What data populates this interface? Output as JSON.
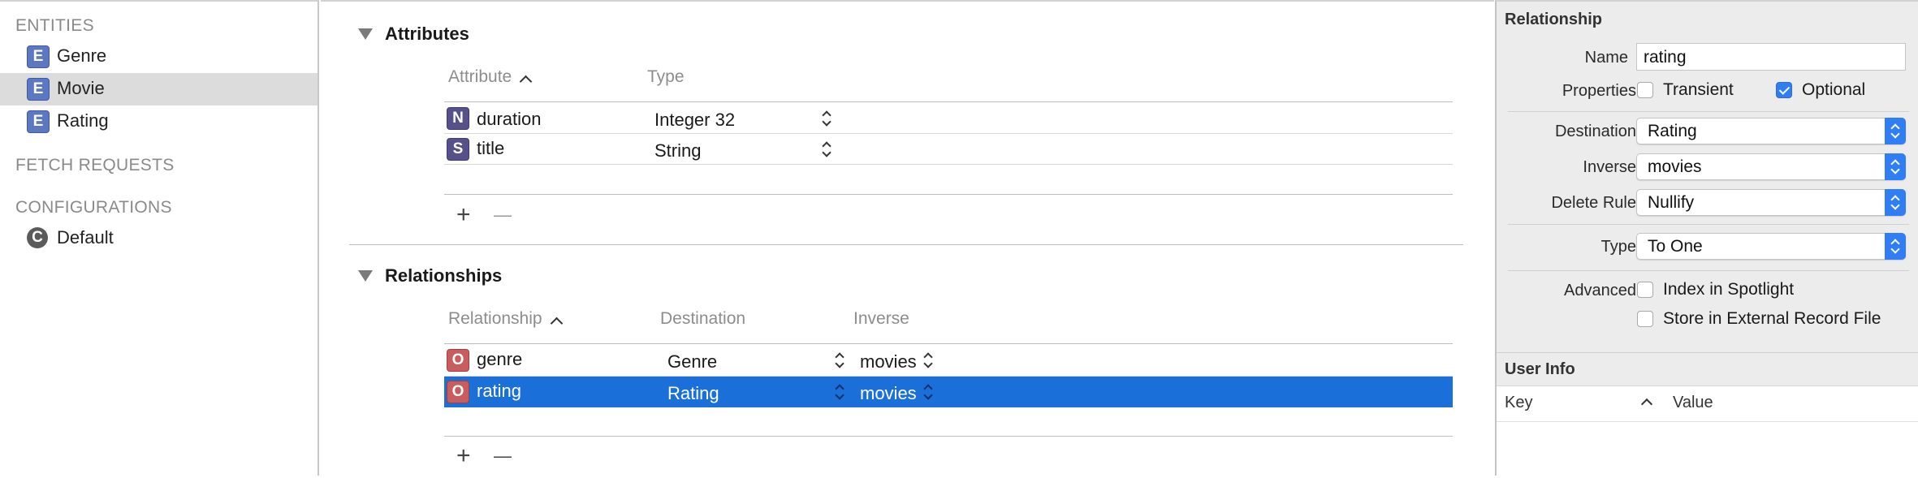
{
  "sidebar": {
    "entities_header": "ENTITIES",
    "entities": [
      {
        "badge": "E",
        "label": "Genre",
        "selected": false
      },
      {
        "badge": "E",
        "label": "Movie",
        "selected": true
      },
      {
        "badge": "E",
        "label": "Rating",
        "selected": false
      }
    ],
    "fetch_requests_header": "FETCH REQUESTS",
    "configurations_header": "CONFIGURATIONS",
    "configurations": [
      {
        "badge": "C",
        "label": "Default"
      }
    ]
  },
  "attributes": {
    "title": "Attributes",
    "col_attribute": "Attribute",
    "col_type": "Type",
    "rows": [
      {
        "badge": "N",
        "name": "duration",
        "type": "Integer 32"
      },
      {
        "badge": "S",
        "name": "title",
        "type": "String"
      }
    ],
    "add_label": "+",
    "remove_label": "—"
  },
  "relationships": {
    "title": "Relationships",
    "col_relationship": "Relationship",
    "col_destination": "Destination",
    "col_inverse": "Inverse",
    "rows": [
      {
        "badge": "O",
        "name": "genre",
        "destination": "Genre",
        "inverse": "movies",
        "selected": false
      },
      {
        "badge": "O",
        "name": "rating",
        "destination": "Rating",
        "inverse": "movies",
        "selected": true
      }
    ],
    "add_label": "+",
    "remove_label": "—"
  },
  "inspector": {
    "header": "Relationship",
    "name_label": "Name",
    "name_value": "rating",
    "properties_label": "Properties",
    "transient_label": "Transient",
    "transient_checked": false,
    "optional_label": "Optional",
    "optional_checked": true,
    "destination_label": "Destination",
    "destination_value": "Rating",
    "inverse_label": "Inverse",
    "inverse_value": "movies",
    "delete_rule_label": "Delete Rule",
    "delete_rule_value": "Nullify",
    "type_label": "Type",
    "type_value": "To One",
    "advanced_label": "Advanced",
    "index_spotlight_label": "Index in Spotlight",
    "index_spotlight_checked": false,
    "external_record_label": "Store in External Record File",
    "external_record_checked": false,
    "user_info_header": "User Info",
    "col_key": "Key",
    "col_value": "Value"
  },
  "colors": {
    "selection": "#1a6fd8",
    "accent": "#2f7ef6",
    "entity_badge": "#5c78c2",
    "relationship_badge": "#c95d5d"
  }
}
